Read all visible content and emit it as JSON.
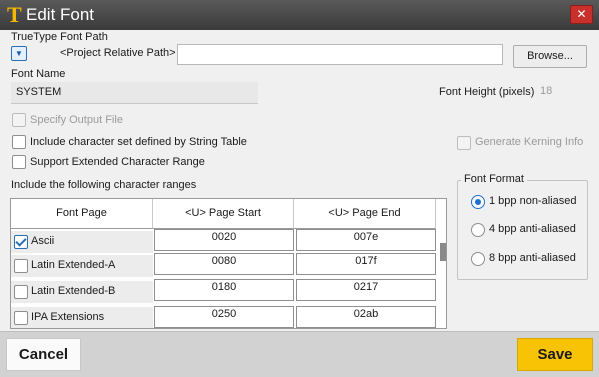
{
  "window": {
    "title": "Edit Font",
    "close": "✕",
    "app_icon": "T"
  },
  "truetype": {
    "label": "TrueType Font Path",
    "path_mode": "<Project Relative Path>",
    "path_value": "",
    "browse": "Browse..."
  },
  "font_name": {
    "label": "Font Name",
    "value": "SYSTEM"
  },
  "font_height": {
    "label": "Font Height (pixels)",
    "value": "18"
  },
  "options": {
    "specify_output": "Specify Output File",
    "include_string_table": "Include character set defined by String Table",
    "extended_range": "Support Extended Character Range",
    "kerning": "Generate Kerning Info"
  },
  "ranges": {
    "label": "Include the following character ranges",
    "headers": [
      "Font Page",
      "<U> Page Start",
      "<U> Page End"
    ],
    "rows": [
      {
        "name": "Ascii",
        "start": "0020",
        "end": "007e",
        "checked": true
      },
      {
        "name": "Latin Extended-A",
        "start": "0080",
        "end": "017f",
        "checked": false
      },
      {
        "name": "Latin Extended-B",
        "start": "0180",
        "end": "0217",
        "checked": false
      },
      {
        "name": "IPA Extensions",
        "start": "0250",
        "end": "02ab",
        "checked": false
      }
    ]
  },
  "font_format": {
    "legend": "Font Format",
    "options": [
      "1 bpp non-aliased",
      "4 bpp anti-aliased",
      "8 bpp anti-aliased"
    ],
    "selected": "1 bpp non-aliased"
  },
  "footer": {
    "cancel": "Cancel",
    "save": "Save"
  },
  "colors": {
    "accent": "#f8c304",
    "titlebar": "#444444",
    "close": "#c9302c",
    "radio": "#1f6fc9"
  }
}
